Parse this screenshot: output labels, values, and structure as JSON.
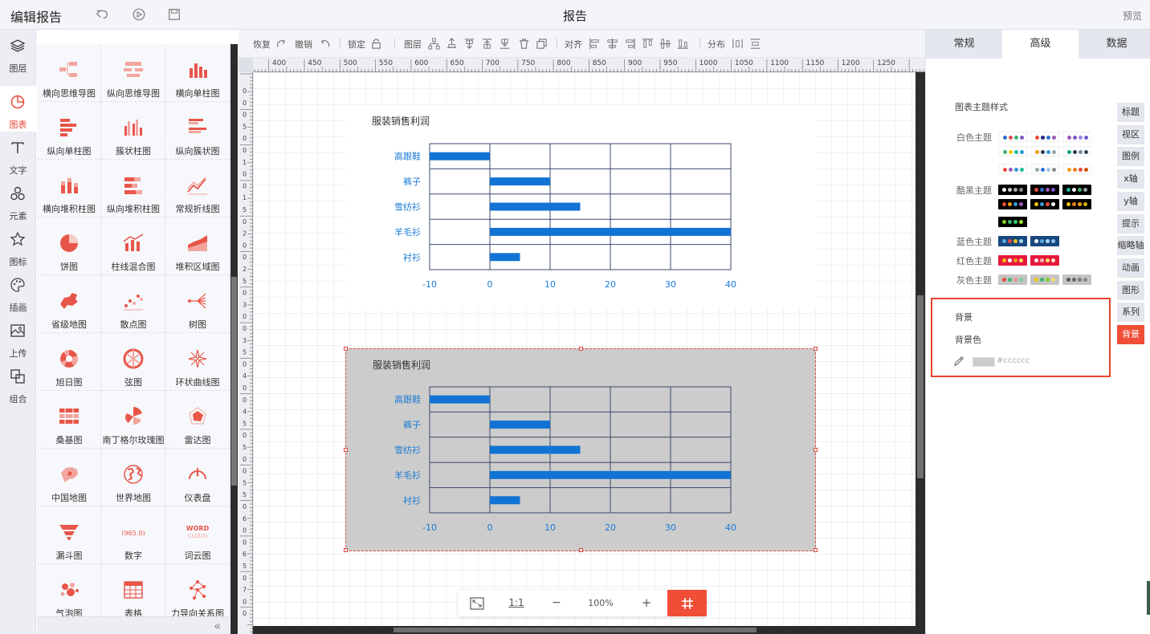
{
  "app": {
    "title": "编辑报告",
    "report_title": "报告",
    "preview": "预览"
  },
  "top_icons": [
    "undo-icon",
    "play-icon",
    "save-icon"
  ],
  "nav": [
    {
      "label": "图层",
      "icon": "layers-icon",
      "active": false
    },
    {
      "label": "图表",
      "icon": "chart-pie-icon",
      "active": true
    },
    {
      "label": "文字",
      "icon": "text-icon",
      "active": false
    },
    {
      "label": "元素",
      "icon": "shapes-icon",
      "active": false
    },
    {
      "label": "图标",
      "icon": "star-icon",
      "active": false
    },
    {
      "label": "插画",
      "icon": "palette-icon",
      "active": false
    },
    {
      "label": "上传",
      "icon": "image-upload-icon",
      "active": false
    },
    {
      "label": "组合",
      "icon": "group-icon",
      "active": false
    }
  ],
  "widgets": [
    {
      "label": "横向思维导图",
      "icon": "mindmap-h"
    },
    {
      "label": "纵向思维导图",
      "icon": "mindmap-v"
    },
    {
      "label": "横向单柱图",
      "icon": "bar-v"
    },
    {
      "label": "纵向单柱图",
      "icon": "bar-h"
    },
    {
      "label": "簇状柱图",
      "icon": "bar-cluster"
    },
    {
      "label": "纵向簇状图",
      "icon": "bar-h-cluster"
    },
    {
      "label": "横向堆积柱图",
      "icon": "bar-stack"
    },
    {
      "label": "纵向堆积柱图",
      "icon": "bar-h-stack"
    },
    {
      "label": "常规折线图",
      "icon": "line"
    },
    {
      "label": "饼图",
      "icon": "pie"
    },
    {
      "label": "柱线混合图",
      "icon": "bar-line"
    },
    {
      "label": "堆积区域图",
      "icon": "area"
    },
    {
      "label": "省级地图",
      "icon": "map-province"
    },
    {
      "label": "散点图",
      "icon": "scatter"
    },
    {
      "label": "树图",
      "icon": "tree"
    },
    {
      "label": "旭日图",
      "icon": "sunburst"
    },
    {
      "label": "弦图",
      "icon": "chord"
    },
    {
      "label": "环状曲线图",
      "icon": "ring-curve"
    },
    {
      "label": "桑基图",
      "icon": "sankey"
    },
    {
      "label": "南丁格尔玫瑰图",
      "icon": "rose"
    },
    {
      "label": "雷达图",
      "icon": "radar"
    },
    {
      "label": "中国地图",
      "icon": "map-china"
    },
    {
      "label": "世界地图",
      "icon": "globe"
    },
    {
      "label": "仪表盘",
      "icon": "gauge"
    },
    {
      "label": "漏斗图",
      "icon": "funnel"
    },
    {
      "label": "数字",
      "icon": "number"
    },
    {
      "label": "词云图",
      "icon": "wordcloud"
    },
    {
      "label": "气泡图",
      "icon": "bubble"
    },
    {
      "label": "表格",
      "icon": "table"
    },
    {
      "label": "力导向关系图",
      "icon": "force"
    }
  ],
  "widget_icon_text": {
    "number": "965.0",
    "wordcloud_a": "WORD",
    "wordcloud_b": "CLOUD"
  },
  "toolbar": {
    "redo": "恢复",
    "undo": "撤销",
    "lock": "锁定",
    "layer": "图层",
    "align": "对齐",
    "distribute": "分布"
  },
  "ruler": {
    "h_ticks": [
      "400",
      "450",
      "500",
      "550",
      "600",
      "650",
      "700",
      "750",
      "800",
      "850",
      "900",
      "950",
      "1000",
      "1050",
      "1100",
      "1150",
      "1200",
      "1250"
    ],
    "v_ticks": [
      "0",
      "0",
      "0",
      "5",
      "0",
      "0",
      "1",
      "0",
      "0",
      "1",
      "5",
      "0",
      "2",
      "0",
      "0",
      "2",
      "5",
      "0",
      "3",
      "0",
      "0",
      "3",
      "5",
      "0",
      "4",
      "0",
      "0",
      "4",
      "5",
      "0",
      "5",
      "0",
      "0",
      "5",
      "5",
      "0",
      "6",
      "0",
      "0",
      "6",
      "5",
      "0",
      "7",
      "0",
      "0"
    ]
  },
  "chart_data": [
    {
      "type": "bar",
      "orientation": "horizontal",
      "title": "服装销售利润",
      "categories": [
        "高跟鞋",
        "裤子",
        "雪纺衫",
        "羊毛衫",
        "衬衫"
      ],
      "values": [
        -10,
        10,
        15,
        40,
        5
      ],
      "xlim": [
        -10,
        40
      ],
      "xticks": [
        "-10",
        "0",
        "10",
        "20",
        "30",
        "40"
      ],
      "grid": true,
      "bar_color": "#1173d4",
      "background": "#ffffff"
    },
    {
      "type": "bar",
      "orientation": "horizontal",
      "title": "服装销售利润",
      "categories": [
        "高跟鞋",
        "裤子",
        "雪纺衫",
        "羊毛衫",
        "衬衫"
      ],
      "values": [
        -10,
        10,
        15,
        40,
        5
      ],
      "xlim": [
        -10,
        40
      ],
      "xticks": [
        "-10",
        "0",
        "10",
        "20",
        "30",
        "40"
      ],
      "grid": true,
      "bar_color": "#1173d4",
      "background": "#cccccc",
      "selected": true
    }
  ],
  "zoom": {
    "ratio_label": "1:1",
    "minus": "−",
    "plus": "+",
    "level": "100%"
  },
  "right_panel": {
    "tabs": [
      {
        "label": "常规",
        "active": false
      },
      {
        "label": "高级",
        "active": true
      },
      {
        "label": "数据",
        "active": false
      }
    ],
    "theme_heading": "图表主题样式",
    "theme_groups": [
      {
        "label": "白色主题",
        "bg": "#ffffff",
        "swatches": [
          [
            "#2f6fd1",
            "#e24f4f",
            "#3cb371",
            "#7d57c2"
          ],
          [
            "#e84b3c",
            "#2a2a7c",
            "#2f6fd1",
            "#9b59b6"
          ],
          [
            "#9b59b6",
            "#7d57c2",
            "#a084e0",
            "#6a5acd"
          ],
          [
            "#3cb371",
            "#f1c40f",
            "#1abc9c",
            "#3498db"
          ],
          [
            "#f39c12",
            "#2c3e50",
            "#3498db",
            "#95a5a6"
          ],
          [
            "#16a085",
            "#2c3e50",
            "#7f8c8d",
            "#34495e"
          ],
          [
            "#e84b3c",
            "#9b59b6",
            "#3498db",
            "#1abc9c"
          ],
          [
            "#95a5a6",
            "#2f6fd1",
            "#a0c4e0",
            "#7f8c8d"
          ],
          [
            "#f39c12",
            "#e67e22",
            "#e84b3c",
            "#d35400"
          ]
        ]
      },
      {
        "label": "酷黑主题",
        "bg": "#000000",
        "swatches": [
          [
            "#ffffff",
            "#cccccc",
            "#aaaaaa",
            "#888888"
          ],
          [
            "#e84b3c",
            "#2f6fd1",
            "#9b59b6",
            "#7d57c2"
          ],
          [
            "#1abc9c",
            "#ffffff",
            "#3cb371",
            "#95a5a6"
          ],
          [
            "#e84b3c",
            "#f39c12",
            "#3498db",
            "#9b59b6"
          ],
          [
            "#f1c40f",
            "#3498db",
            "#e84b3c",
            "#ffffff"
          ],
          [
            "#f1c40f",
            "#e67e22",
            "#f39c12",
            "#d4ac0d"
          ],
          [
            "#7ed321",
            "#3cb371",
            "#2ecc71",
            "#a3e635"
          ]
        ]
      },
      {
        "label": "蓝色主题",
        "bg": "#17487e",
        "swatches": [
          [
            "#5dade2",
            "#e84b3c",
            "#f1c40f",
            "#aed6f1"
          ],
          [
            "#ffffff",
            "#5dade2",
            "#aed6f1",
            "#85c1e9"
          ]
        ]
      },
      {
        "label": "红色主题",
        "bg": "#e5173c",
        "swatches": [
          [
            "#f1c40f",
            "#ffffff",
            "#f39c12",
            "#ffe066"
          ],
          [
            "#ffffff",
            "#f5b7b1",
            "#ffe066",
            "#fdebd0"
          ]
        ]
      },
      {
        "label": "灰色主题",
        "bg": "#c4c4c4",
        "swatches": [
          [
            "#e84b3c",
            "#3cb371",
            "#f1948a",
            "#7dcea0"
          ],
          [
            "#f1c40f",
            "#3cb371",
            "#7ed321",
            "#f7dc6f"
          ],
          [
            "#555555",
            "#666666",
            "#777777",
            "#888888"
          ]
        ]
      }
    ],
    "side_tabs": [
      {
        "label": "标题",
        "active": false
      },
      {
        "label": "视区",
        "active": false
      },
      {
        "label": "图例",
        "active": false
      },
      {
        "label": "x轴",
        "active": false
      },
      {
        "label": "y轴",
        "active": false
      },
      {
        "label": "提示",
        "active": false
      },
      {
        "label": "缩略轴",
        "active": false
      },
      {
        "label": "动画",
        "active": false
      },
      {
        "label": "图形",
        "active": false
      },
      {
        "label": "系列",
        "active": false
      },
      {
        "label": "背景",
        "active": true
      }
    ],
    "background": {
      "title": "背景",
      "color_label": "背景色",
      "color_value": "#cccccc",
      "picker_icon": "eyedropper-icon"
    }
  }
}
